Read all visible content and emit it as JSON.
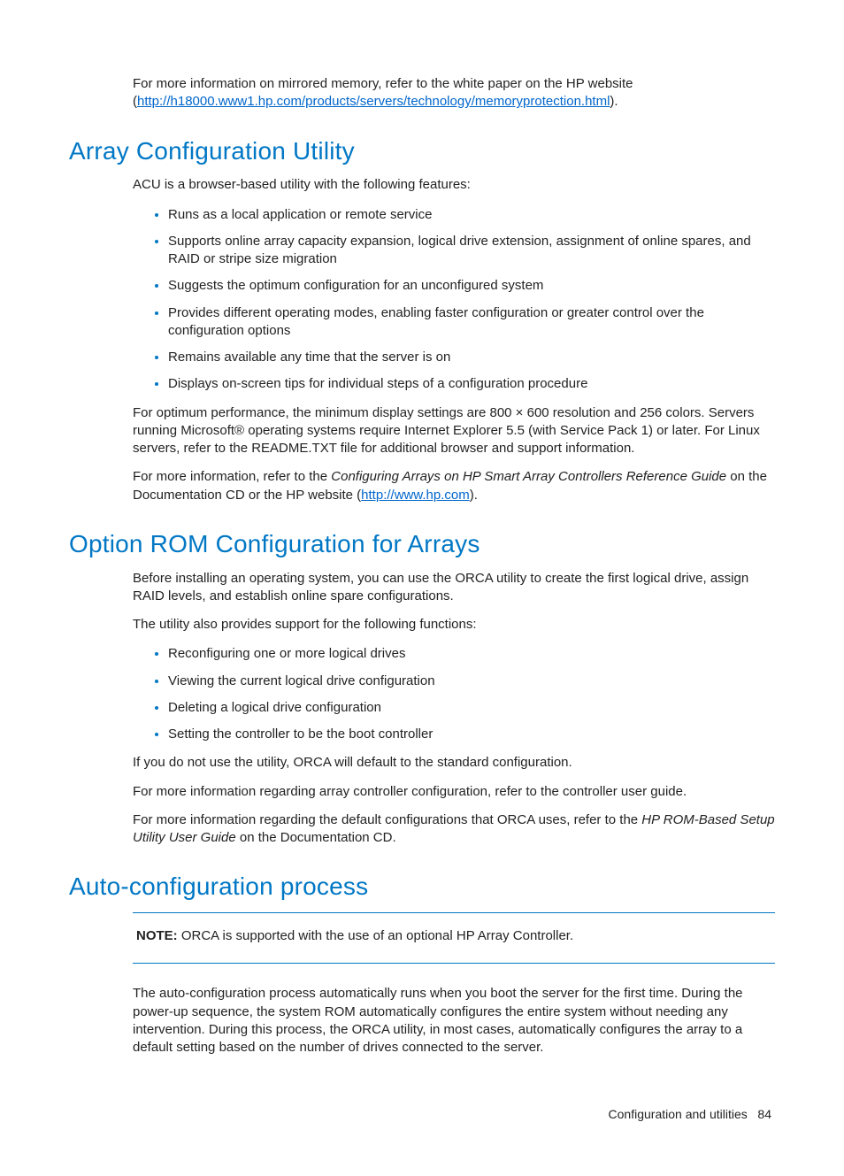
{
  "intro": {
    "pre": "For more information on mirrored memory, refer to the white paper on the HP website (",
    "link": "http://h18000.www1.hp.com/products/servers/technology/memoryprotection.html",
    "post": ")."
  },
  "sec1": {
    "heading": "Array Configuration Utility",
    "p1": "ACU is a browser-based utility with the following features:",
    "bullets": [
      "Runs as a local application or remote service",
      "Supports online array capacity expansion, logical drive extension, assignment of online spares, and RAID or stripe size migration",
      "Suggests the optimum configuration for an unconfigured system",
      "Provides different operating modes, enabling faster configuration or greater control over the configuration options",
      "Remains available any time that the server is on",
      "Displays on-screen tips for individual steps of a configuration procedure"
    ],
    "p2": "For optimum performance, the minimum display settings are 800 × 600 resolution and 256 colors. Servers running Microsoft® operating systems require Internet Explorer 5.5 (with Service Pack 1) or later. For Linux servers, refer to the README.TXT file for additional browser and support information.",
    "p3_pre": "For more information, refer to the ",
    "p3_it": "Configuring Arrays on HP Smart Array Controllers Reference Guide",
    "p3_mid": " on the Documentation CD or the HP website (",
    "p3_link": "http://www.hp.com",
    "p3_post": ")."
  },
  "sec2": {
    "heading": "Option ROM Configuration for Arrays",
    "p1": "Before installing an operating system, you can use the ORCA utility to create the first logical drive, assign RAID levels, and establish online spare configurations.",
    "p2": "The utility also provides support for the following functions:",
    "bullets": [
      "Reconfiguring one or more logical drives",
      "Viewing the current logical drive configuration",
      "Deleting a logical drive configuration",
      "Setting the controller to be the boot controller"
    ],
    "p3": "If you do not use the utility, ORCA will default to the standard configuration.",
    "p4": "For more information regarding array controller configuration, refer to the controller user guide.",
    "p5_pre": "For more information regarding the default configurations that ORCA uses, refer to the ",
    "p5_it": "HP ROM-Based Setup Utility User Guide",
    "p5_post": " on the Documentation CD."
  },
  "sec3": {
    "heading": "Auto-configuration process",
    "note_label": "NOTE:",
    "note_text": "  ORCA is supported with the use of an optional HP Array Controller.",
    "p1": "The auto-configuration process automatically runs when you boot the server for the first time. During the power-up sequence, the system ROM automatically configures the entire system without needing any intervention. During this process, the ORCA utility, in most cases, automatically configures the array to a default setting based on the number of drives connected to the server."
  },
  "footer": {
    "section": "Configuration and utilities",
    "page": "84"
  }
}
